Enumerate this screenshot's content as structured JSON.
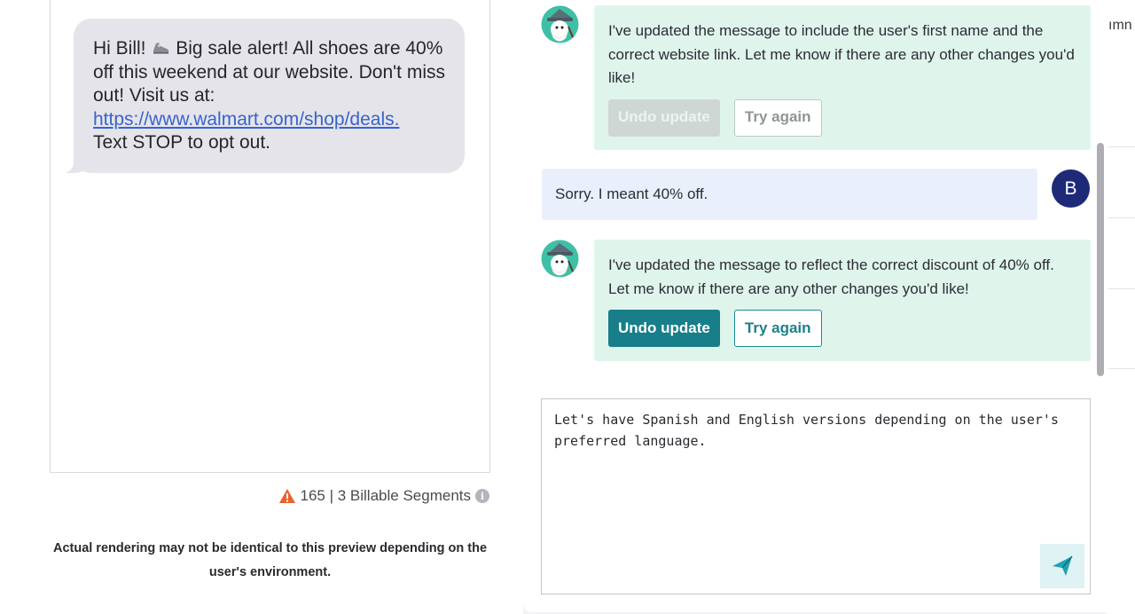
{
  "preview": {
    "message_lines": [
      "Hi Bill! ",
      " Big sale alert! All shoes are 40% off this weekend at our website. Don't miss out! Visit us at: "
    ],
    "greeting": "Hi Bill!",
    "body": "Big sale alert! All shoes are 40% off this weekend at our website. Don't miss out! Visit us at:",
    "link": "https://www.walmart.com/shop/deals.",
    "footer": "Text STOP to opt out.",
    "char_count": "165 | 3 Billable Segments",
    "disclaimer": "Actual rendering may not be identical to this preview depending on the user's environment."
  },
  "chat": {
    "bot_message_1": "I've updated the message to include the user's first name and the correct website link. Let me know if there are any other changes you'd like!",
    "user_message": "Sorry. I meant 40% off.",
    "user_initial": "B",
    "bot_message_2": "I've updated the message to reflect the correct discount of 40% off. Let me know if there are any other changes you'd like!",
    "undo_label": "Undo update",
    "try_again_label": "Try again",
    "composer_value": "Let's have Spanish and English versions depending on the user's preferred language."
  },
  "edge": {
    "fragment": "ımn"
  },
  "colors": {
    "bot_bg": "#dff5ec",
    "user_bg": "#e9f0fb",
    "accent": "#177e8a",
    "user_avatar": "#1e2a78",
    "warning": "#e8632b"
  }
}
